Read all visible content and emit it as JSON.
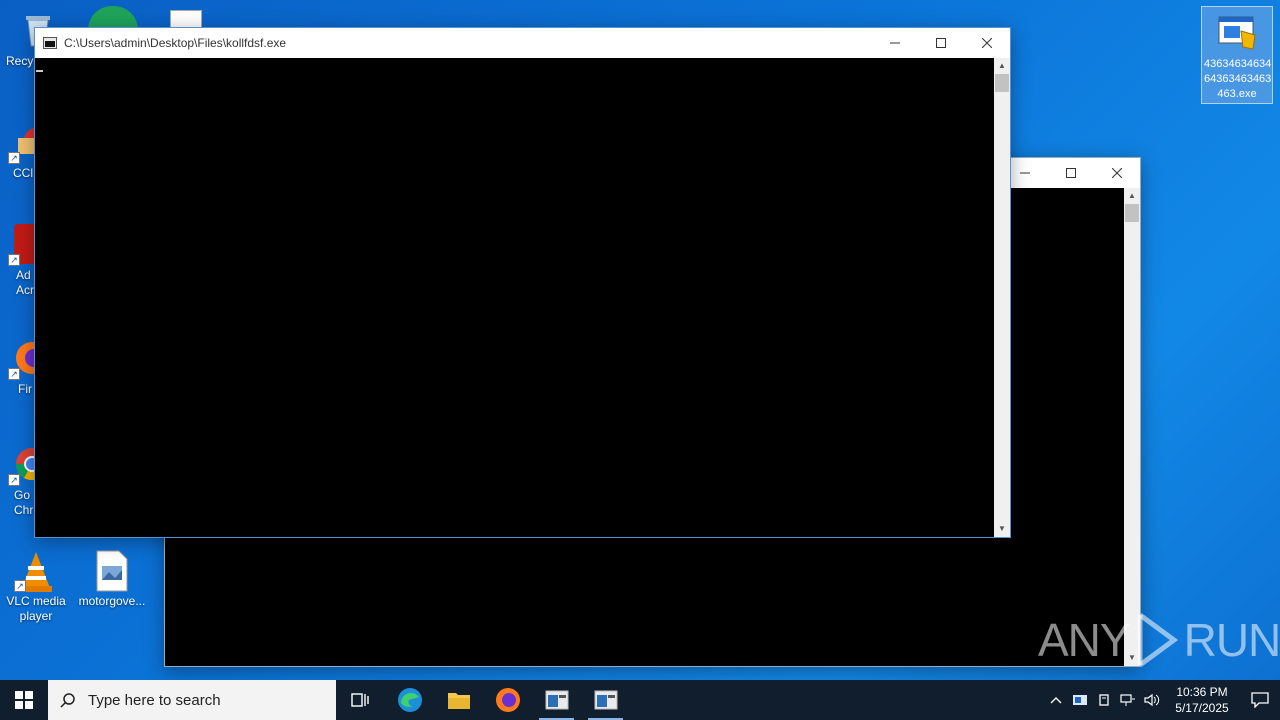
{
  "desktop": {
    "icons": [
      {
        "label": "Recy",
        "name": "recycle-bin"
      },
      {
        "label": "CCl",
        "name": "ccleaner"
      },
      {
        "label": "Ad\nAcr",
        "name": "adobe-acrobat"
      },
      {
        "label": "Fir",
        "name": "firefox"
      },
      {
        "label": "Go\nChr",
        "name": "google-chrome"
      },
      {
        "label": "VLC media player",
        "name": "vlc"
      },
      {
        "label": "motorgove...",
        "name": "motorgove-file"
      }
    ],
    "selected_icon_label": "43634634634 64363463463 463.exe"
  },
  "front_window": {
    "title": "C:\\Users\\admin\\Desktop\\Files\\kollfdsf.exe"
  },
  "back_window": {
    "title": ""
  },
  "taskbar": {
    "search_placeholder": "Type here to search",
    "time": "10:36 PM",
    "date": "5/17/2025"
  },
  "watermark": {
    "left": "ANY",
    "right": "RUN"
  },
  "colors": {
    "desktop_bg": "#0b74d8",
    "taskbar_bg": "#101e2e",
    "console_bg": "#000000"
  }
}
